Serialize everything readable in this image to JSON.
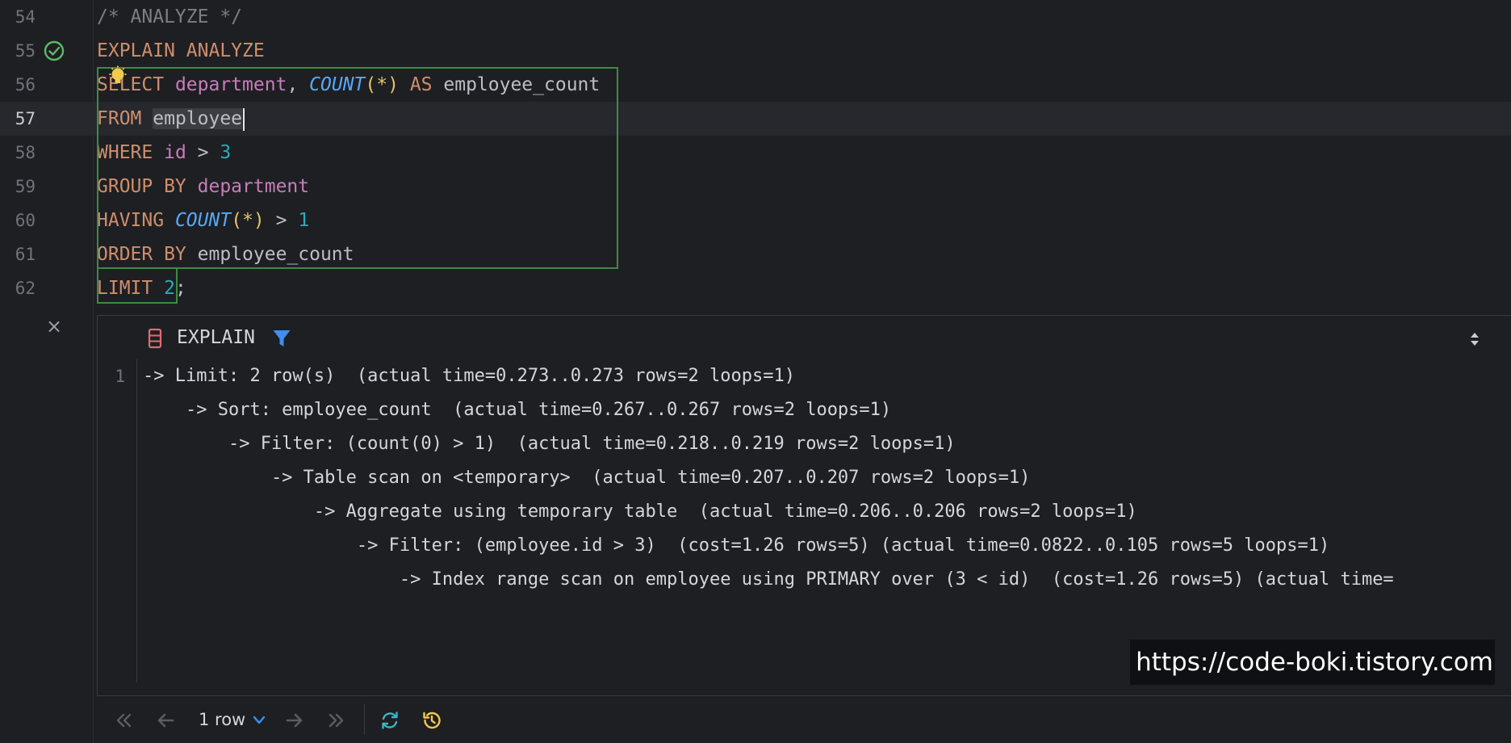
{
  "editor": {
    "lines": [
      {
        "num": "54"
      },
      {
        "num": "55"
      },
      {
        "num": "56"
      },
      {
        "num": "57"
      },
      {
        "num": "58"
      },
      {
        "num": "59"
      },
      {
        "num": "60"
      },
      {
        "num": "61"
      },
      {
        "num": "62"
      }
    ],
    "code": {
      "l54": "/* ANALYZE */",
      "l55": "EXPLAIN ANALYZE",
      "l56_select": "SELECT",
      "l56_dept": "department",
      "l56_comma": ",",
      "l56_count": "COUNT",
      "l56_star": "(*)",
      "l56_as": "AS",
      "l56_alias": "employee_count",
      "l57_from": "FROM",
      "l57_table": "employee",
      "l58_where": "WHERE",
      "l58_col": "id",
      "l58_op": ">",
      "l58_num": "3",
      "l59_group": "GROUP BY",
      "l59_col": "department",
      "l60_having": "HAVING",
      "l60_count": "COUNT",
      "l60_star": "(*)",
      "l60_op": ">",
      "l60_num": "1",
      "l61_order": "ORDER BY",
      "l61_col": "employee_count",
      "l62_limit": "LIMIT",
      "l62_num": "2",
      "l62_semi": ";"
    }
  },
  "panel": {
    "title": "EXPLAIN",
    "close": "×",
    "row_number": "1",
    "result_lines": [
      "-> Limit: 2 row(s)  (actual time=0.273..0.273 rows=2 loops=1)",
      "    -> Sort: employee_count  (actual time=0.267..0.267 rows=2 loops=1)",
      "        -> Filter: (count(0) > 1)  (actual time=0.218..0.219 rows=2 loops=1)",
      "            -> Table scan on <temporary>  (actual time=0.207..0.207 rows=2 loops=1)",
      "                -> Aggregate using temporary table  (actual time=0.206..0.206 rows=2 loops=1)",
      "                    -> Filter: (employee.id > 3)  (cost=1.26 rows=5) (actual time=0.0822..0.105 rows=5 loops=1)",
      "                        -> Index range scan on employee using PRIMARY over (3 < id)  (cost=1.26 rows=5) (actual time="
    ]
  },
  "footer": {
    "rows_label": "1 row"
  },
  "watermark": "https://code-boki.tistory.com",
  "icons": {
    "check": "check-circle-icon",
    "bulb": "lightbulb-icon",
    "explain": "table-icon",
    "filter": "filter-icon",
    "sort": "sort-icon",
    "first": "first-page-icon",
    "prev": "prev-page-icon",
    "next": "next-page-icon",
    "last": "last-page-icon",
    "refresh": "refresh-icon",
    "history": "history-icon"
  },
  "colors": {
    "keyword": "#cf8e6d",
    "column": "#c77dbb",
    "function": "#56a8f5",
    "number": "#2aacb8",
    "paren": "#e0c46c",
    "comment": "#7a7e85",
    "selection_border": "#3e8a45",
    "background": "#1e1f22"
  }
}
